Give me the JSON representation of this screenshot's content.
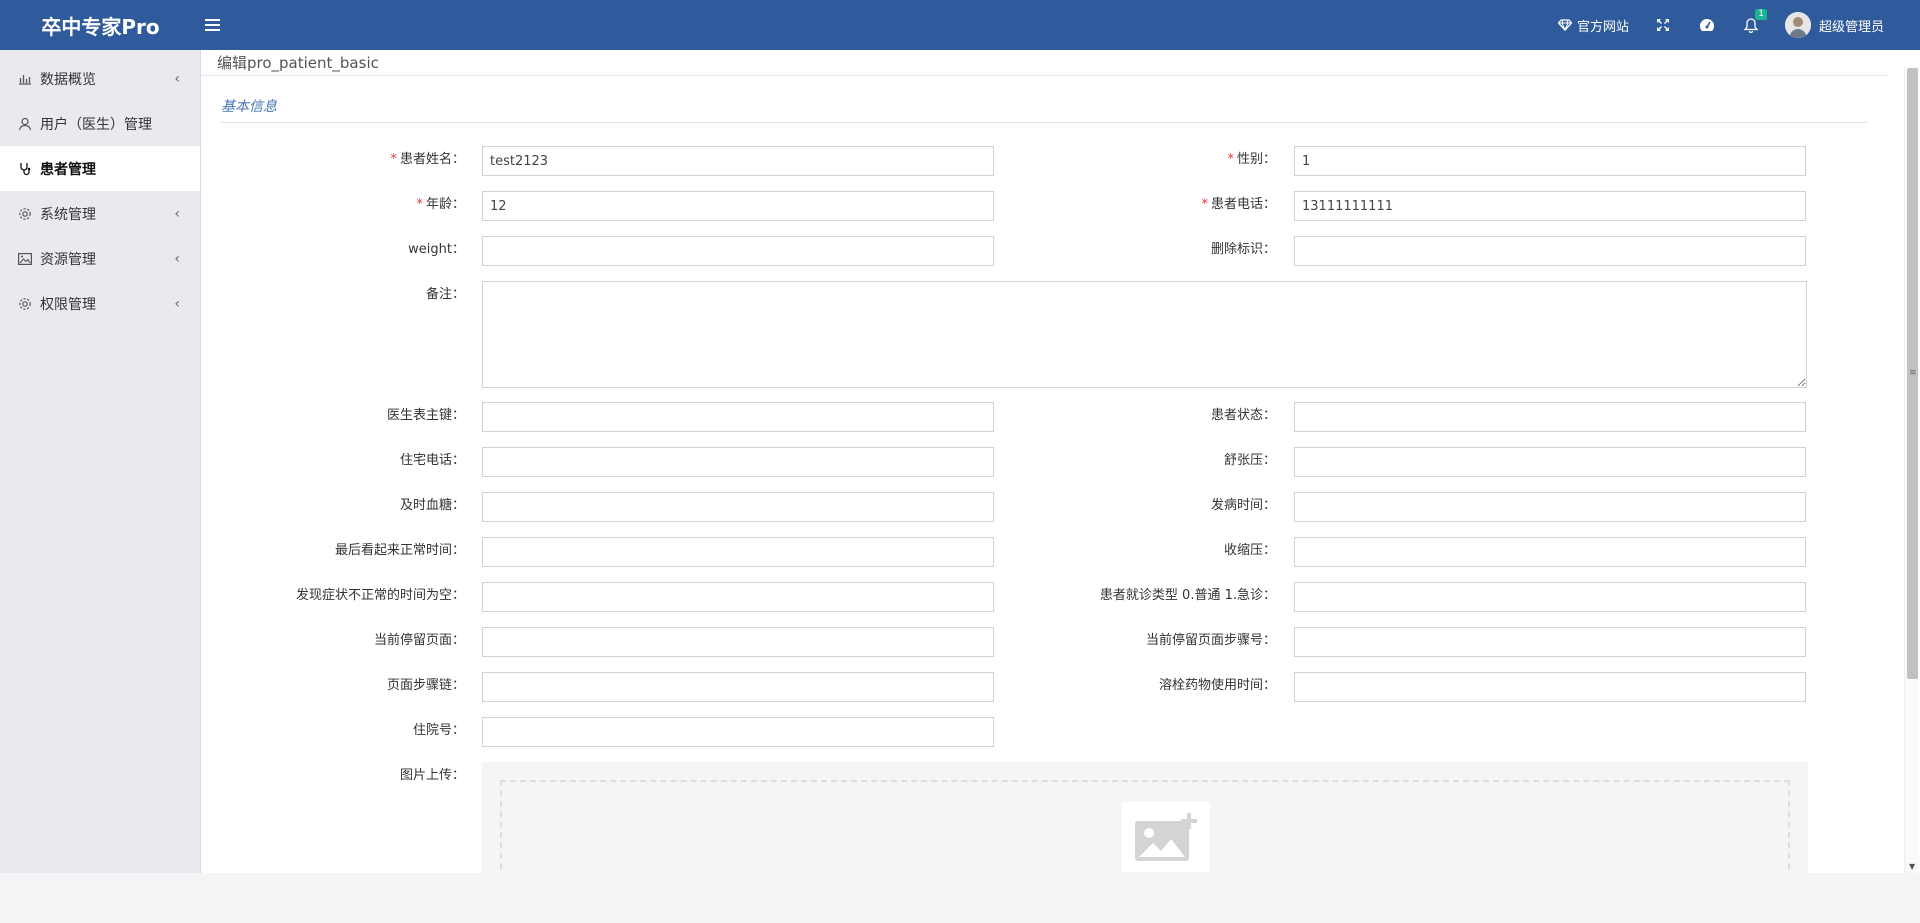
{
  "app": {
    "title": "卒中专家Pro"
  },
  "header": {
    "official_site": "官方网站",
    "notification_count": "1",
    "user_name": "超级管理员"
  },
  "sidebar": {
    "items": [
      {
        "label": "数据概览",
        "icon": "bar-chart-icon",
        "has_chevron": true
      },
      {
        "label": "用户（医生）管理",
        "icon": "user-icon",
        "has_chevron": false
      },
      {
        "label": "患者管理",
        "icon": "stethoscope-icon",
        "has_chevron": false,
        "active": true
      },
      {
        "label": "系统管理",
        "icon": "gear-icon",
        "has_chevron": true
      },
      {
        "label": "资源管理",
        "icon": "image-icon",
        "has_chevron": true
      },
      {
        "label": "权限管理",
        "icon": "gear-icon",
        "has_chevron": true
      }
    ]
  },
  "page": {
    "heading": "编辑pro_patient_basic",
    "section_title": "基本信息"
  },
  "form": {
    "patient_name": {
      "label": "患者姓名：",
      "value": "test2123",
      "required": true
    },
    "gender": {
      "label": "性别：",
      "value": "1",
      "required": true
    },
    "age": {
      "label": "年龄：",
      "value": "12",
      "required": true
    },
    "phone": {
      "label": "患者电话：",
      "value": "13111111111",
      "required": true
    },
    "weight": {
      "label": "weight：",
      "value": ""
    },
    "delete_flag": {
      "label": "删除标识：",
      "value": ""
    },
    "remark": {
      "label": "备注：",
      "value": ""
    },
    "doctor_key": {
      "label": "医生表主键：",
      "value": ""
    },
    "patient_status": {
      "label": "患者状态：",
      "value": ""
    },
    "home_phone": {
      "label": "住宅电话：",
      "value": ""
    },
    "diastolic": {
      "label": "舒张压：",
      "value": ""
    },
    "blood_sugar": {
      "label": "及时血糖：",
      "value": ""
    },
    "onset_time": {
      "label": "发病时间：",
      "value": ""
    },
    "last_normal_time": {
      "label": "最后看起来正常时间：",
      "value": ""
    },
    "systolic": {
      "label": "收缩压：",
      "value": ""
    },
    "symptom_time_null": {
      "label": "发现症状不正常的时间为空：",
      "value": ""
    },
    "visit_type": {
      "label": "患者就诊类型 0.普通 1.急诊：",
      "value": ""
    },
    "current_page": {
      "label": "当前停留页面：",
      "value": ""
    },
    "current_step": {
      "label": "当前停留页面步骤号：",
      "value": ""
    },
    "step_chain": {
      "label": "页面步骤链：",
      "value": ""
    },
    "thrombolysis_time": {
      "label": "溶栓药物使用时间：",
      "value": ""
    },
    "admission_no": {
      "label": "住院号：",
      "value": ""
    },
    "image_upload": {
      "label": "图片上传："
    }
  },
  "colors": {
    "topbar": "#2f5b9c",
    "sidebar_bg": "#e8eaee",
    "required_mark": "#e4393c",
    "section_title": "#4a77b9"
  }
}
